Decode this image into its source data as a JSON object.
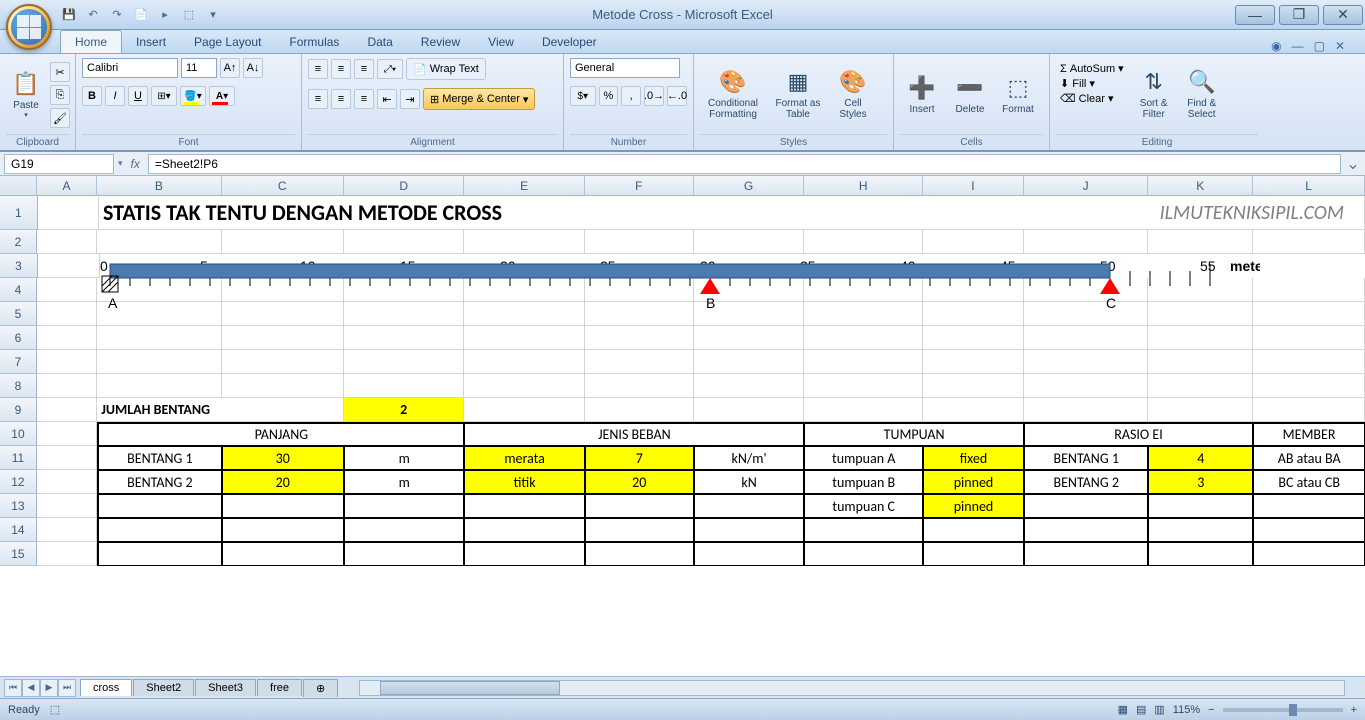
{
  "app": {
    "title": "Metode Cross - Microsoft Excel"
  },
  "tabs": [
    "Home",
    "Insert",
    "Page Layout",
    "Formulas",
    "Data",
    "Review",
    "View",
    "Developer"
  ],
  "active_tab": "Home",
  "ribbon": {
    "clipboard": {
      "paste": "Paste",
      "label": "Clipboard"
    },
    "font": {
      "name": "Calibri",
      "size": "11",
      "label": "Font"
    },
    "alignment": {
      "wrap": "Wrap Text",
      "merge": "Merge & Center",
      "label": "Alignment"
    },
    "number": {
      "format": "General",
      "label": "Number"
    },
    "styles": {
      "cf": "Conditional Formatting",
      "ft": "Format as Table",
      "cs": "Cell Styles",
      "label": "Styles"
    },
    "cells": {
      "ins": "Insert",
      "del": "Delete",
      "fmt": "Format",
      "label": "Cells"
    },
    "editing": {
      "sum": "AutoSum",
      "fill": "Fill",
      "clear": "Clear",
      "sort": "Sort & Filter",
      "find": "Find & Select",
      "label": "Editing"
    }
  },
  "formula_bar": {
    "name_box": "G19",
    "formula": "=Sheet2!P6"
  },
  "columns": [
    "A",
    "B",
    "C",
    "D",
    "E",
    "F",
    "G",
    "H",
    "I",
    "J",
    "K",
    "L"
  ],
  "rows_visible": 15,
  "sheet": {
    "title": "STATIS TAK TENTU DENGAN METODE CROSS",
    "watermark": "ILMUTEKNIKSIPIL.COM",
    "scale_ticks": [
      "0",
      "5",
      "10",
      "15",
      "20",
      "25",
      "30",
      "35",
      "40",
      "45",
      "50",
      "55"
    ],
    "scale_unit": "meter",
    "supports": [
      "A",
      "B",
      "C"
    ],
    "jumlah_bentang_label": "JUMLAH BENTANG",
    "jumlah_bentang_value": "2",
    "headers": {
      "panjang": "PANJANG",
      "jenis": "JENIS BEBAN",
      "tumpuan": "TUMPUAN",
      "rasio": "RASIO EI",
      "member": "MEMBER"
    },
    "data_rows": [
      {
        "b": "BENTANG 1",
        "c": "30",
        "d": "m",
        "e": "merata",
        "f": "7",
        "g": "kN/m'",
        "h": "tumpuan A",
        "i": "fixed",
        "j": "BENTANG 1",
        "k": "4",
        "l": "AB atau BA"
      },
      {
        "b": "BENTANG 2",
        "c": "20",
        "d": "m",
        "e": "titik",
        "f": "20",
        "g": "kN",
        "h": "tumpuan B",
        "i": "pinned",
        "j": "BENTANG 2",
        "k": "3",
        "l": "BC atau CB"
      },
      {
        "b": "",
        "c": "",
        "d": "",
        "e": "",
        "f": "",
        "g": "",
        "h": "tumpuan C",
        "i": "pinned",
        "j": "",
        "k": "",
        "l": ""
      }
    ]
  },
  "sheet_tabs": [
    "cross",
    "Sheet2",
    "Sheet3",
    "free"
  ],
  "status": {
    "ready": "Ready",
    "zoom": "115%"
  }
}
